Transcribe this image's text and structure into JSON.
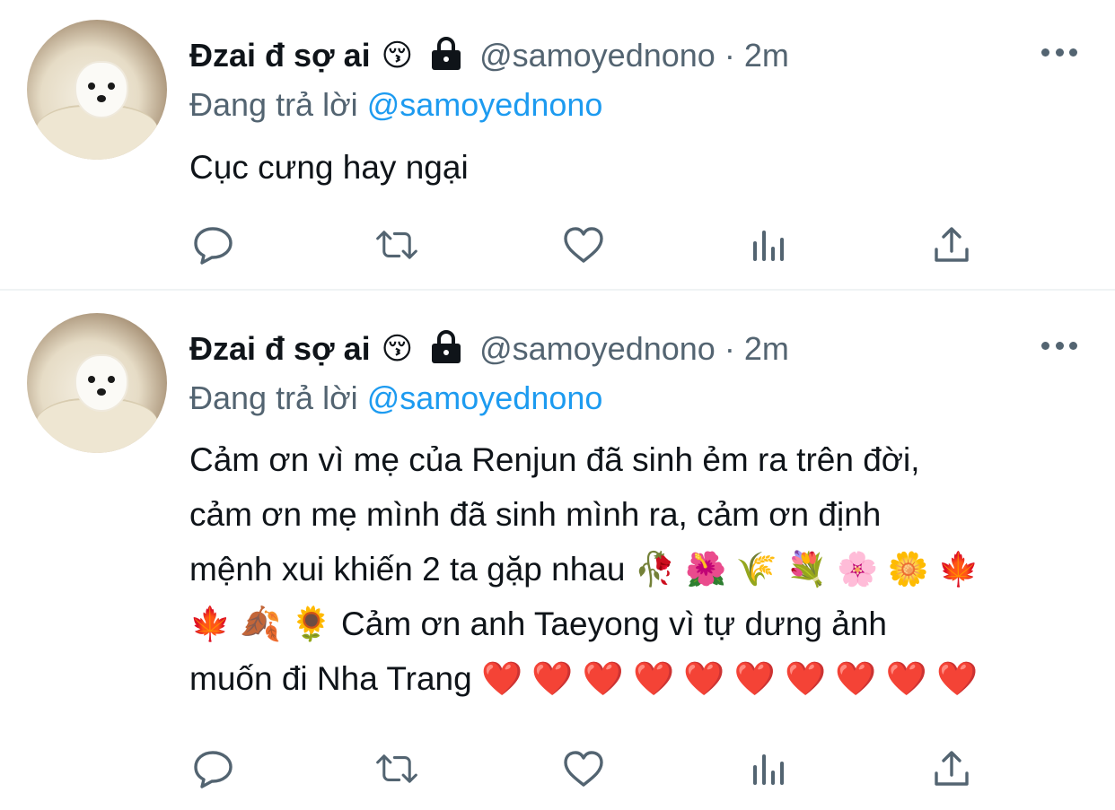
{
  "tweets": [
    {
      "display_name": "Đzai đ sợ ai",
      "name_emoji": "😚",
      "handle": "@samoyednono",
      "dot": "·",
      "time": "2m",
      "reply_prefix": "Đang trả lời",
      "reply_to": "@samoyednono",
      "lines": [
        "Cục cưng hay ngại"
      ]
    },
    {
      "display_name": "Đzai đ sợ ai",
      "name_emoji": "😚",
      "handle": "@samoyednono",
      "dot": "·",
      "time": "2m",
      "reply_prefix": "Đang trả lời",
      "reply_to": "@samoyednono",
      "lines": [
        "Cảm ơn vì mẹ của Renjun đã sinh ẻm ra trên đời,",
        "cảm ơn mẹ mình đã sinh mình ra, cảm ơn định",
        "mệnh xui khiến 2 ta gặp nhau 🥀 🌺 🌾 💐 🌸 🌼 🍁",
        "🍁 🍂 🌻  Cảm ơn anh Taeyong vì tự dưng ảnh",
        "muốn đi Nha Trang ❤️ ❤️ ❤️ ❤️ ❤️ ❤️ ❤️ ❤️ ❤️ ❤️"
      ]
    }
  ],
  "icons": {
    "more": "more-icon",
    "lock": "lock-icon",
    "reply": "reply-icon",
    "retweet": "retweet-icon",
    "like": "like-icon",
    "views": "views-icon",
    "share": "share-icon"
  },
  "colors": {
    "text": "#0f1419",
    "secondary": "#536471",
    "link": "#1d9bf0",
    "divider": "#eff3f4"
  }
}
